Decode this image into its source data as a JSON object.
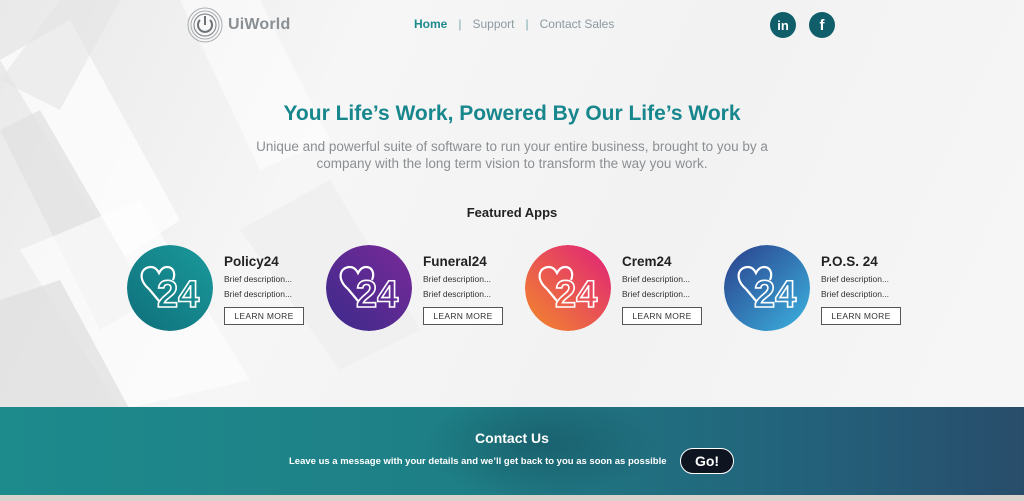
{
  "header": {
    "logo_text": "UiWorld",
    "nav": [
      {
        "label": "Home",
        "active": true
      },
      {
        "label": "Support",
        "active": false
      },
      {
        "label": "Contact Sales",
        "active": false
      }
    ],
    "social": [
      {
        "icon": "linkedin-icon",
        "glyph": "in"
      },
      {
        "icon": "facebook-icon",
        "glyph": "f"
      }
    ]
  },
  "hero": {
    "title": "Your Life’s Work, Powered By Our Life’s Work",
    "subtitle": "Unique and powerful suite of software to run your entire business, brought to you by a company with the long term vision to transform the way you work."
  },
  "featured": {
    "heading": "Featured Apps",
    "apps": [
      {
        "name": "Policy24",
        "desc1": "Brief description...",
        "desc2": "Brief description...",
        "button": "LEARN MORE",
        "colors": [
          "#0f6f7a",
          "#1a9a9c"
        ]
      },
      {
        "name": "Funeral24",
        "desc1": "Brief description...",
        "desc2": "Brief description...",
        "button": "LEARN MORE",
        "colors": [
          "#3b2a8a",
          "#7a2a9a"
        ]
      },
      {
        "name": "Crem24",
        "desc1": "Brief description...",
        "desc2": "Brief description...",
        "button": "LEARN MORE",
        "colors": [
          "#e0207a",
          "#f28a2a"
        ]
      },
      {
        "name": "P.O.S. 24",
        "desc1": "Brief description...",
        "desc2": "Brief description...",
        "button": "LEARN MORE",
        "colors": [
          "#2a3e8a",
          "#3bb3e0"
        ]
      }
    ]
  },
  "contact": {
    "title": "Contact Us",
    "message": "Leave us a message with your details and we’ll get back to you as soon as possible",
    "button": "Go!"
  },
  "colors": {
    "accent": "#17878d",
    "dark_teal": "#0f5e6a"
  }
}
